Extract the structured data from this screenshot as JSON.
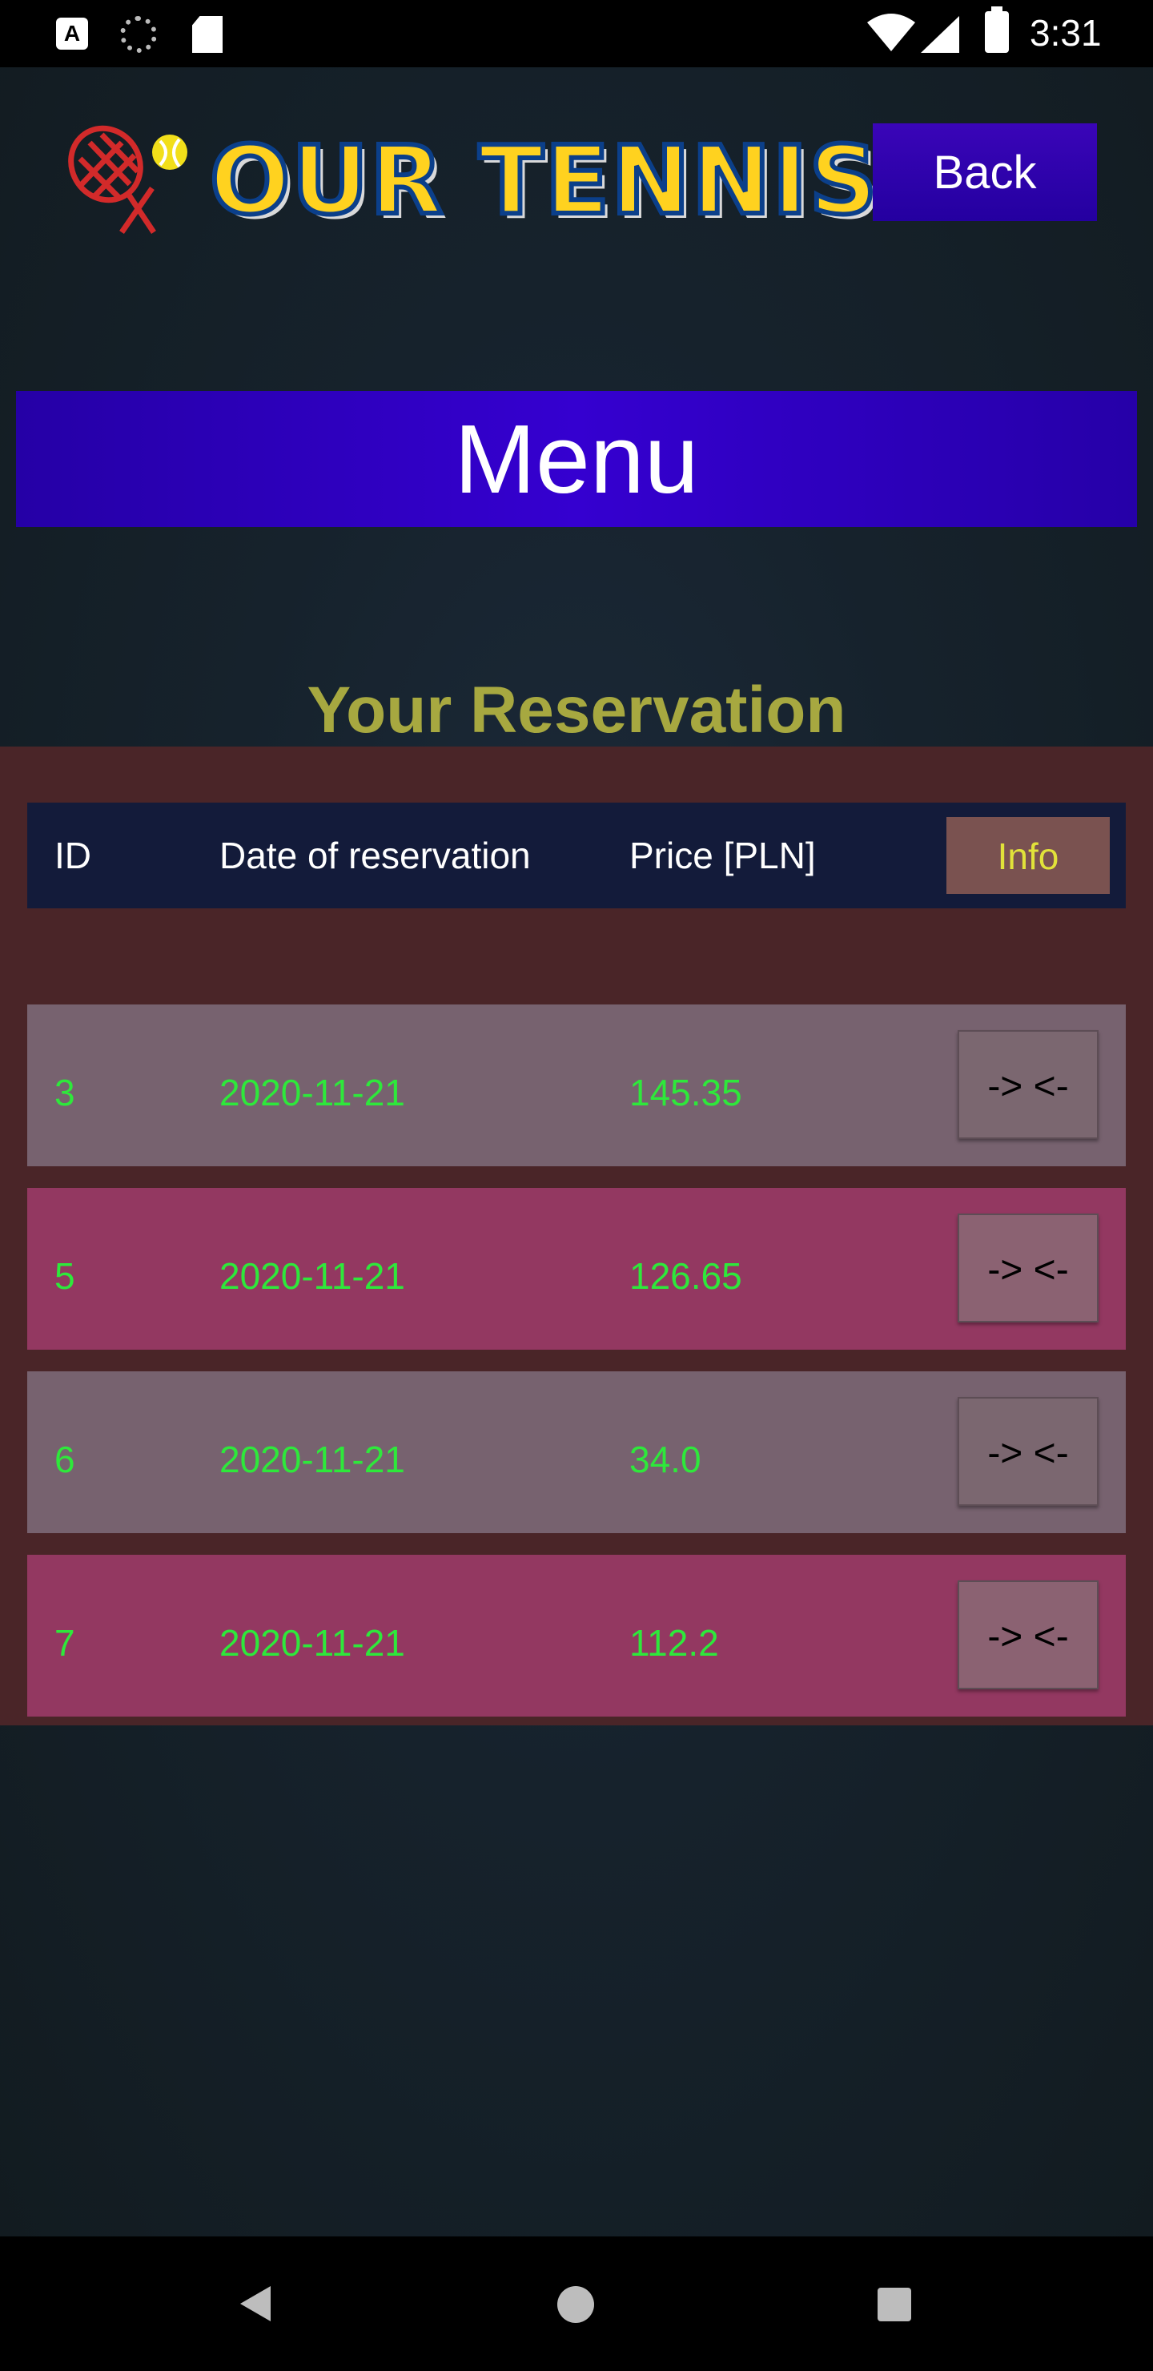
{
  "status_bar": {
    "time": "3:31",
    "icons": [
      "notification-a-icon",
      "spinner-icon",
      "sd-card-icon",
      "wifi-icon",
      "signal-icon",
      "battery-icon"
    ]
  },
  "header": {
    "logo_text": "OUR TENNIS",
    "back_label": "Back"
  },
  "menu": {
    "label": "Menu"
  },
  "reservations": {
    "title": "Your Reservation",
    "columns": {
      "id": "ID",
      "date": "Date of reservation",
      "price": "Price [PLN]",
      "info": "Info"
    },
    "rows": [
      {
        "id": "3",
        "date": "2020-11-21",
        "price": "145.35",
        "action": "-> <-"
      },
      {
        "id": "5",
        "date": "2020-11-21",
        "price": "126.65",
        "action": "-> <-"
      },
      {
        "id": "6",
        "date": "2020-11-21",
        "price": "34.0",
        "action": "-> <-"
      },
      {
        "id": "7",
        "date": "2020-11-21",
        "price": "112.2",
        "action": "-> <-"
      }
    ]
  },
  "colors": {
    "accent_button": "#2400a0",
    "title_text": "#a7a840",
    "row_text": "#2ee83b",
    "info_text": "#e1e23a",
    "row_a": "#77626f",
    "row_b": "#933861"
  },
  "nav_bar": {
    "icons": [
      "back-icon",
      "home-icon",
      "recent-apps-icon"
    ]
  }
}
